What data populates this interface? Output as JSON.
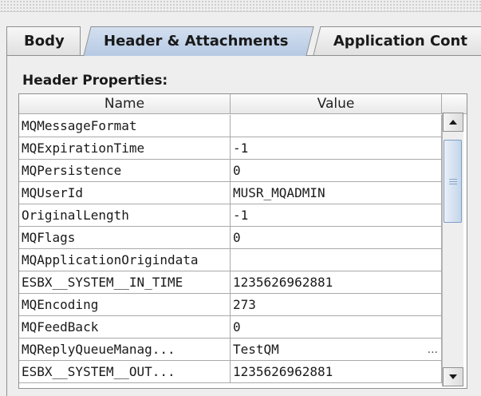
{
  "tabs": [
    {
      "label": "Body",
      "selected": false
    },
    {
      "label": "Header & Attachments",
      "selected": true
    },
    {
      "label": "Application Cont",
      "selected": false
    }
  ],
  "section_title": "Header Properties:",
  "table": {
    "columns": [
      "Name",
      "Value"
    ],
    "rows": [
      {
        "name": "MQMessageFormat",
        "value": ""
      },
      {
        "name": "MQExpirationTime",
        "value": "-1"
      },
      {
        "name": "MQPersistence",
        "value": "0"
      },
      {
        "name": "MQUserId",
        "value": "MUSR_MQADMIN"
      },
      {
        "name": "OriginalLength",
        "value": "-1"
      },
      {
        "name": "MQFlags",
        "value": "0"
      },
      {
        "name": "MQApplicationOrigindata",
        "value": ""
      },
      {
        "name": "ESBX__SYSTEM__IN_TIME",
        "value": "1235626962881"
      },
      {
        "name": "MQEncoding",
        "value": "273"
      },
      {
        "name": "MQFeedBack",
        "value": "0"
      },
      {
        "name": "MQReplyQueueManag...",
        "value": "TestQM",
        "button": "..."
      },
      {
        "name": "ESBX__SYSTEM__OUT...",
        "value": "1235626962881"
      }
    ]
  },
  "scrollbar": {
    "up_icon": "arrow-up-icon",
    "down_icon": "arrow-down-icon"
  }
}
